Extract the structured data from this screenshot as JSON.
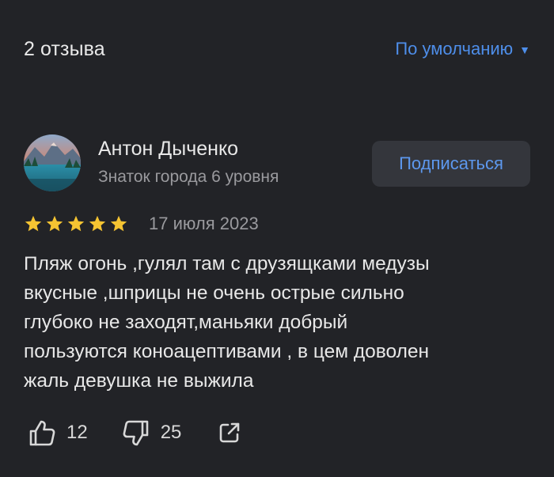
{
  "header": {
    "reviews_count": "2 отзыва",
    "sort_label": "По умолчанию",
    "sort_caret": "▼"
  },
  "review": {
    "author_name": "Антон Дыченко",
    "author_status": "Знаток города 6 уровня",
    "subscribe_label": "Подписаться",
    "rating": 5,
    "rating_max": 5,
    "date": "17 июля 2023",
    "text_lines": [
      "Пляж огонь ,гулял там с друзящками медузы",
      "вкусные ,шприцы не очень острые сильно",
      "глубоко не заходят,маньяки добрый",
      "пользуются коноацептивами , в цем доволен",
      "жаль девушка не выжила"
    ],
    "likes": "12",
    "dislikes": "25"
  },
  "icons": {
    "like": "thumbs-up-icon",
    "dislike": "thumbs-down-icon",
    "share": "share-icon",
    "star": "star-icon"
  },
  "colors": {
    "background": "#222327",
    "accent": "#4e8eea",
    "star": "#f5c432",
    "button_bg": "#34363c"
  }
}
